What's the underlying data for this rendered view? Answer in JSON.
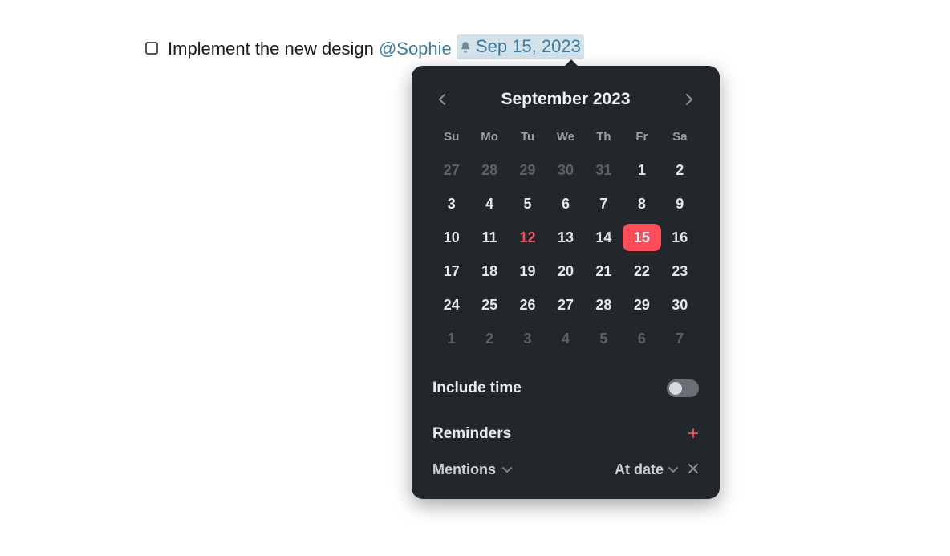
{
  "task": {
    "text_before": "Implement the new design ",
    "mention": "@Sophie",
    "date_label": "Sep 15, 2023"
  },
  "calendar": {
    "title": "September 2023",
    "weekdays": [
      "Su",
      "Mo",
      "Tu",
      "We",
      "Th",
      "Fr",
      "Sa"
    ],
    "weeks": [
      [
        {
          "d": 27,
          "out": true
        },
        {
          "d": 28,
          "out": true
        },
        {
          "d": 29,
          "out": true
        },
        {
          "d": 30,
          "out": true
        },
        {
          "d": 31,
          "out": true
        },
        {
          "d": 1
        },
        {
          "d": 2
        }
      ],
      [
        {
          "d": 3
        },
        {
          "d": 4
        },
        {
          "d": 5
        },
        {
          "d": 6
        },
        {
          "d": 7
        },
        {
          "d": 8
        },
        {
          "d": 9
        }
      ],
      [
        {
          "d": 10
        },
        {
          "d": 11
        },
        {
          "d": 12,
          "today": true
        },
        {
          "d": 13
        },
        {
          "d": 14
        },
        {
          "d": 15,
          "selected": true
        },
        {
          "d": 16
        }
      ],
      [
        {
          "d": 17
        },
        {
          "d": 18
        },
        {
          "d": 19
        },
        {
          "d": 20
        },
        {
          "d": 21
        },
        {
          "d": 22
        },
        {
          "d": 23
        }
      ],
      [
        {
          "d": 24
        },
        {
          "d": 25
        },
        {
          "d": 26
        },
        {
          "d": 27
        },
        {
          "d": 28
        },
        {
          "d": 29
        },
        {
          "d": 30
        }
      ],
      [
        {
          "d": 1,
          "out": true
        },
        {
          "d": 2,
          "out": true
        },
        {
          "d": 3,
          "out": true
        },
        {
          "d": 4,
          "out": true
        },
        {
          "d": 5,
          "out": true
        },
        {
          "d": 6,
          "out": true
        },
        {
          "d": 7,
          "out": true
        }
      ]
    ]
  },
  "include_time": {
    "label": "Include time",
    "enabled": false
  },
  "reminders": {
    "heading": "Reminders",
    "target": "Mentions",
    "when": "At date"
  }
}
